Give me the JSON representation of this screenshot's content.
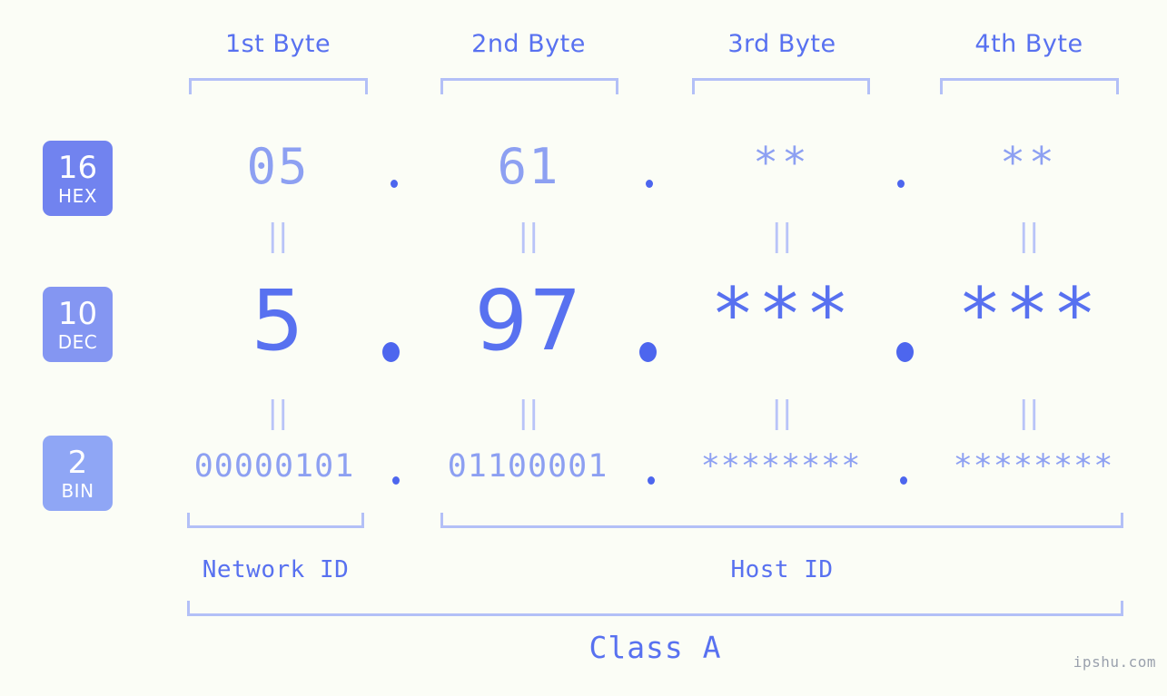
{
  "background_color": "#fbfdf6",
  "accent_color": "#5871f0",
  "accent_light_color": "#8da0f2",
  "bracket_color": "#b3c0f7",
  "byte_headers": [
    {
      "label": "1st Byte"
    },
    {
      "label": "2nd Byte"
    },
    {
      "label": "3rd Byte"
    },
    {
      "label": "4th Byte"
    }
  ],
  "bases": [
    {
      "number": "16",
      "name": "HEX",
      "color": "#7183ef"
    },
    {
      "number": "10",
      "name": "DEC",
      "color": "#8496f2"
    },
    {
      "number": "2",
      "name": "BIN",
      "color": "#8fa6f5"
    }
  ],
  "rows": {
    "hex": {
      "values": [
        "05",
        "61",
        "**",
        "**"
      ],
      "separators": [
        ".",
        ".",
        "."
      ]
    },
    "dec": {
      "values": [
        "5",
        "97",
        "***",
        "***"
      ],
      "separators": [
        ".",
        ".",
        "."
      ]
    },
    "bin": {
      "values": [
        "00000101",
        "01100001",
        "********",
        "********"
      ],
      "separators": [
        ".",
        ".",
        "."
      ]
    }
  },
  "connectors": {
    "glyph": "||"
  },
  "segments": {
    "network_id": "Network ID",
    "host_id": "Host ID"
  },
  "class_label": "Class A",
  "watermark": "ipshu.com"
}
